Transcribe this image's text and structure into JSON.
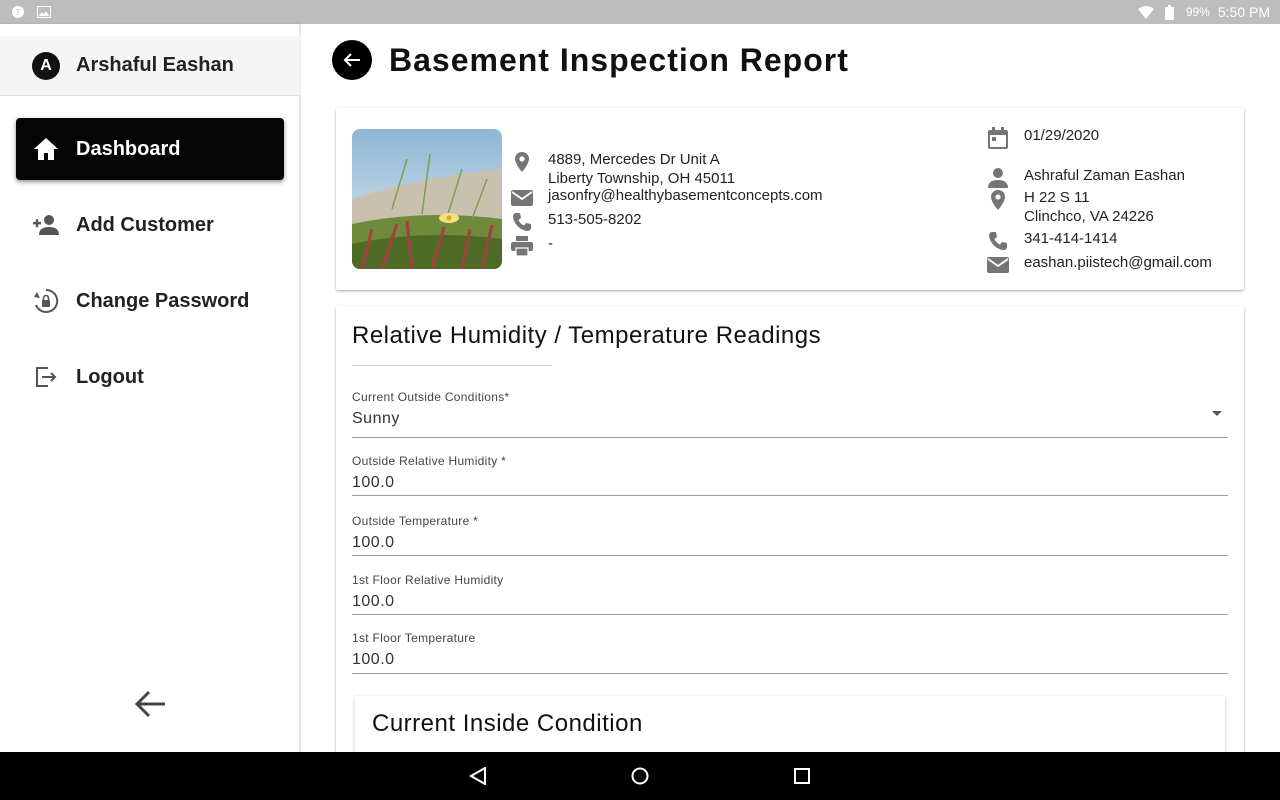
{
  "status_bar": {
    "battery_percent": "99%",
    "time": "5:50 PM"
  },
  "sidebar": {
    "user": {
      "initial": "A",
      "name": "Arshaful Eashan"
    },
    "items": [
      {
        "label": "Dashboard",
        "icon": "home-icon",
        "active": true
      },
      {
        "label": "Add Customer",
        "icon": "person-add-icon",
        "active": false
      },
      {
        "label": "Change Password",
        "icon": "lock-reset-icon",
        "active": false
      },
      {
        "label": "Logout",
        "icon": "logout-icon",
        "active": false
      }
    ]
  },
  "header": {
    "title": "Basement Inspection Report"
  },
  "customer": {
    "address_line1": "4889, Mercedes Dr Unit A",
    "address_line2": "Liberty Township, OH 45011",
    "email": "jasonfry@healthybasementconcepts.com",
    "phone": "513-505-8202",
    "fax": "-"
  },
  "inspection": {
    "date": "01/29/2020",
    "inspector_name": "Ashraful Zaman Eashan",
    "address_line1": "H 22 S 11",
    "address_line2": "Clinchco, VA 24226",
    "phone": "341-414-1414",
    "email": "eashan.piistech@gmail.com"
  },
  "readings": {
    "section_title": "Relative Humidity / Temperature Readings",
    "fields": [
      {
        "label": "Current Outside Conditions*",
        "value": "Sunny",
        "type": "dropdown"
      },
      {
        "label": "Outside Relative Humidity *",
        "value": "100.0",
        "type": "input"
      },
      {
        "label": "Outside Temperature *",
        "value": "100.0",
        "type": "input"
      },
      {
        "label": "1st Floor Relative Humidity",
        "value": "100.0",
        "type": "input"
      },
      {
        "label": "1st Floor Temperature",
        "value": "100.0",
        "type": "input"
      }
    ],
    "inside_section_title": "Current Inside Condition"
  },
  "colors": {
    "active_nav_bg": "#050505",
    "status_bar_bg": "#bdbdbd",
    "nav_bar_bg": "#000000"
  }
}
